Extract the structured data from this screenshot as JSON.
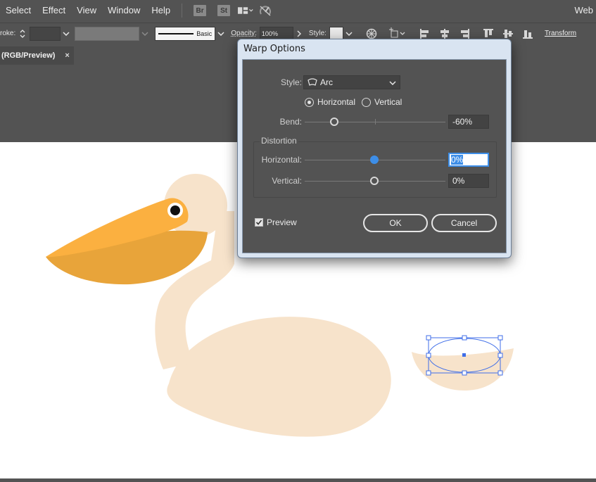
{
  "menubar": {
    "items": [
      "Select",
      "Effect",
      "View",
      "Window",
      "Help"
    ],
    "bridge_badge": "Br",
    "stock_badge": "St",
    "workspace": "Web"
  },
  "controlbar": {
    "stroke_label": "roke:",
    "brush_label": "Basic",
    "opacity_label": "Opacity:",
    "opacity_value": "100%",
    "style_label": "Style:",
    "transform_label": "Transform"
  },
  "document": {
    "tab_label": "(RGB/Preview)",
    "tab_close": "×"
  },
  "dialog": {
    "title": "Warp Options",
    "style_label": "Style:",
    "style_value": "Arc",
    "orientation": {
      "horizontal_label": "Horizontal",
      "vertical_label": "Vertical",
      "selected": "Horizontal"
    },
    "bend_label": "Bend:",
    "bend_value": "-60%",
    "bend_percent": -60,
    "distortion_label": "Distortion",
    "dist_horizontal_label": "Horizontal:",
    "dist_horizontal_value": "0%",
    "dist_horizontal_percent": 0,
    "dist_vertical_label": "Vertical:",
    "dist_vertical_value": "0%",
    "dist_vertical_percent": 0,
    "preview_label": "Preview",
    "preview_checked": true,
    "ok_label": "OK",
    "cancel_label": "Cancel"
  },
  "colors": {
    "ui_bg": "#535353",
    "pelican_body": "#f7e3cb",
    "beak_top": "#fbb040",
    "beak_bottom": "#e8a43a",
    "selection": "#3f6ee8",
    "slider_active": "#3d8ee8"
  }
}
